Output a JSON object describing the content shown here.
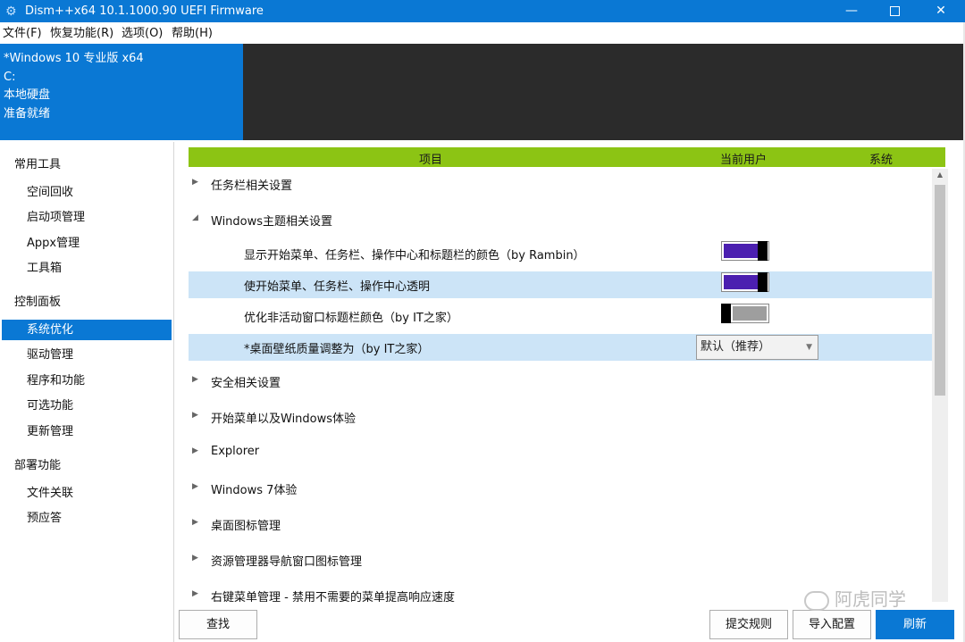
{
  "window": {
    "title": "Dism++x64 10.1.1000.90 UEFI Firmware",
    "min_glyph": "—",
    "close_glyph": "✕"
  },
  "menu": [
    "文件(F)",
    "恢复功能(R)",
    "选项(O)",
    "帮助(H)"
  ],
  "info": {
    "os": "*Windows 10 专业版 x64",
    "drive": "C:",
    "disk": "本地硬盘",
    "status": "准备就绪"
  },
  "nav": {
    "groups": [
      {
        "label": "常用工具",
        "items": [
          "空间回收",
          "启动项管理",
          "Appx管理",
          "工具箱"
        ]
      },
      {
        "label": "控制面板",
        "items": [
          "系统优化",
          "驱动管理",
          "程序和功能",
          "可选功能",
          "更新管理"
        ]
      },
      {
        "label": "部署功能",
        "items": [
          "文件关联",
          "预应答"
        ]
      }
    ],
    "active": "系统优化"
  },
  "table": {
    "columns": [
      "项目",
      "当前用户",
      "系统"
    ],
    "rows": [
      {
        "label": "任务栏相关设置",
        "type": "group",
        "expanded": false
      },
      {
        "label": "Windows主题相关设置",
        "type": "group",
        "expanded": true
      },
      {
        "label": "显示开始菜单、任务栏、操作中心和标题栏的颜色（by Rambin）",
        "type": "toggle",
        "user_state": "on"
      },
      {
        "label": "使开始菜单、任务栏、操作中心透明",
        "type": "toggle",
        "user_state": "on",
        "selected": true
      },
      {
        "label": "优化非活动窗口标题栏颜色（by IT之家）",
        "type": "toggle",
        "user_state": "off"
      },
      {
        "label": "*桌面壁纸质量调整为（by IT之家）",
        "type": "select",
        "value": "默认（推荐）",
        "selected": true
      },
      {
        "label": "安全相关设置",
        "type": "group",
        "expanded": false
      },
      {
        "label": "开始菜单以及Windows体验",
        "type": "group",
        "expanded": false
      },
      {
        "label": "Explorer",
        "type": "group",
        "expanded": false
      },
      {
        "label": "Windows 7体验",
        "type": "group",
        "expanded": false
      },
      {
        "label": "桌面图标管理",
        "type": "group",
        "expanded": false
      },
      {
        "label": "资源管理器导航窗口图标管理",
        "type": "group",
        "expanded": false
      },
      {
        "label": "右键菜单管理 - 禁用不需要的菜单提高响应速度",
        "type": "group",
        "expanded": false
      }
    ]
  },
  "buttons": {
    "find": "查找",
    "submit": "提交规则",
    "import": "导入配置",
    "refresh": "刷新"
  },
  "watermark": "阿虎同学",
  "colors": {
    "accent": "#0a78d4",
    "header": "#8cc414",
    "toggle_on": "#4b1fb0",
    "selected_row": "#cce4f7"
  }
}
